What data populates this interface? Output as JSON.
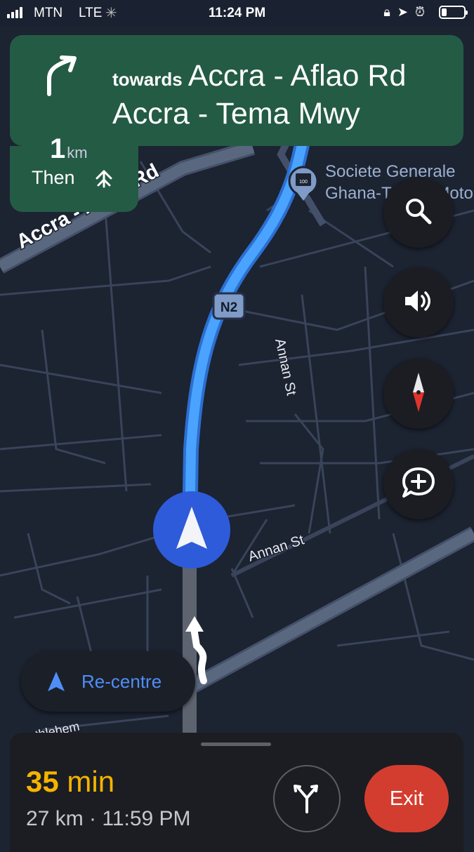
{
  "status": {
    "carrier": "MTN",
    "network": "LTE",
    "time": "11:24 PM"
  },
  "nav": {
    "distance_value": "1",
    "distance_unit": "km",
    "towards_label": "towards",
    "destination": "Accra - Aflao Rd",
    "road": "Accra - Tema Mwy",
    "then_label": "Then",
    "maneuver_icon": "turn-slight-right-icon",
    "then_icon": "merge-icon"
  },
  "map": {
    "road_label_main": "Accra - Aflao Rd",
    "poi_name_line1": "Societe Generale",
    "poi_name_line2": "Ghana-Toyota Moto",
    "highway_shield": "N2",
    "street_1": "Annan St",
    "street_2": "Annan St",
    "street_3": "Bethlehem",
    "route_color": "#4aa3ff",
    "background_color": "#1c2331"
  },
  "controls": {
    "search_icon": "search-icon",
    "sound_icon": "volume-icon",
    "compass_icon": "compass-icon",
    "report_icon": "add-report-icon",
    "recentre_label": "Re-centre"
  },
  "trip": {
    "eta_value": "35",
    "eta_unit": "min",
    "summary": "27 km · 11:59 PM",
    "alt_routes_icon": "alt-routes-icon",
    "exit_label": "Exit",
    "eta_color": "#f5b400",
    "exit_color": "#d33d2f"
  }
}
